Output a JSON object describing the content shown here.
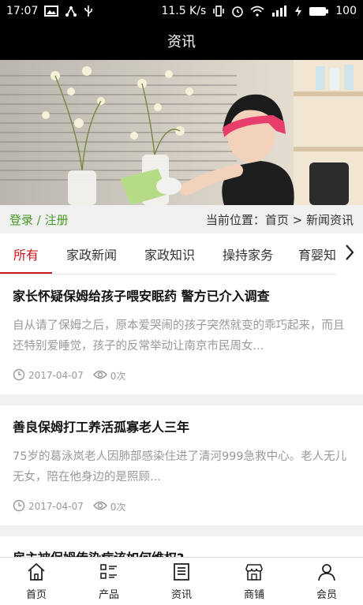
{
  "status_bar": {
    "time": "17:07",
    "network_speed": "11.5 K/s",
    "battery": "100"
  },
  "header": {
    "title": "资讯"
  },
  "location_bar": {
    "login_label": "登录 / 注册",
    "breadcrumb": "当前位置：首页 > 新闻资讯"
  },
  "tabs": [
    {
      "label": "所有",
      "active": true
    },
    {
      "label": "家政新闻"
    },
    {
      "label": "家政知识"
    },
    {
      "label": "操持家务"
    },
    {
      "label": "育婴知"
    }
  ],
  "articles": [
    {
      "title": "家长怀疑保姆给孩子喂安眠药 警方已介入调查",
      "summary": "自从请了保姆之后，原本爱哭闹的孩子突然就变的乖巧起来，而且还特别爱睡觉，孩子的反常举动让南京市民周女...",
      "date": "2017-04-07",
      "views": "0次"
    },
    {
      "title": "善良保姆打工养活孤寡老人三年",
      "summary": "75岁的葛泳岚老人因肺部感染住进了清河999急救中心。老人无儿无女，陪在他身边的是照顾...",
      "date": "2017-04-07",
      "views": "0次"
    },
    {
      "title": "雇主被保姆传染病该如何维权?",
      "summary": "",
      "date": "",
      "views": ""
    }
  ],
  "bottom_nav": [
    {
      "label": "首页",
      "icon": "home-icon"
    },
    {
      "label": "产品",
      "icon": "grid-list-icon"
    },
    {
      "label": "资讯",
      "icon": "news-icon"
    },
    {
      "label": "商铺",
      "icon": "shop-icon"
    },
    {
      "label": "会员",
      "icon": "user-icon"
    }
  ]
}
